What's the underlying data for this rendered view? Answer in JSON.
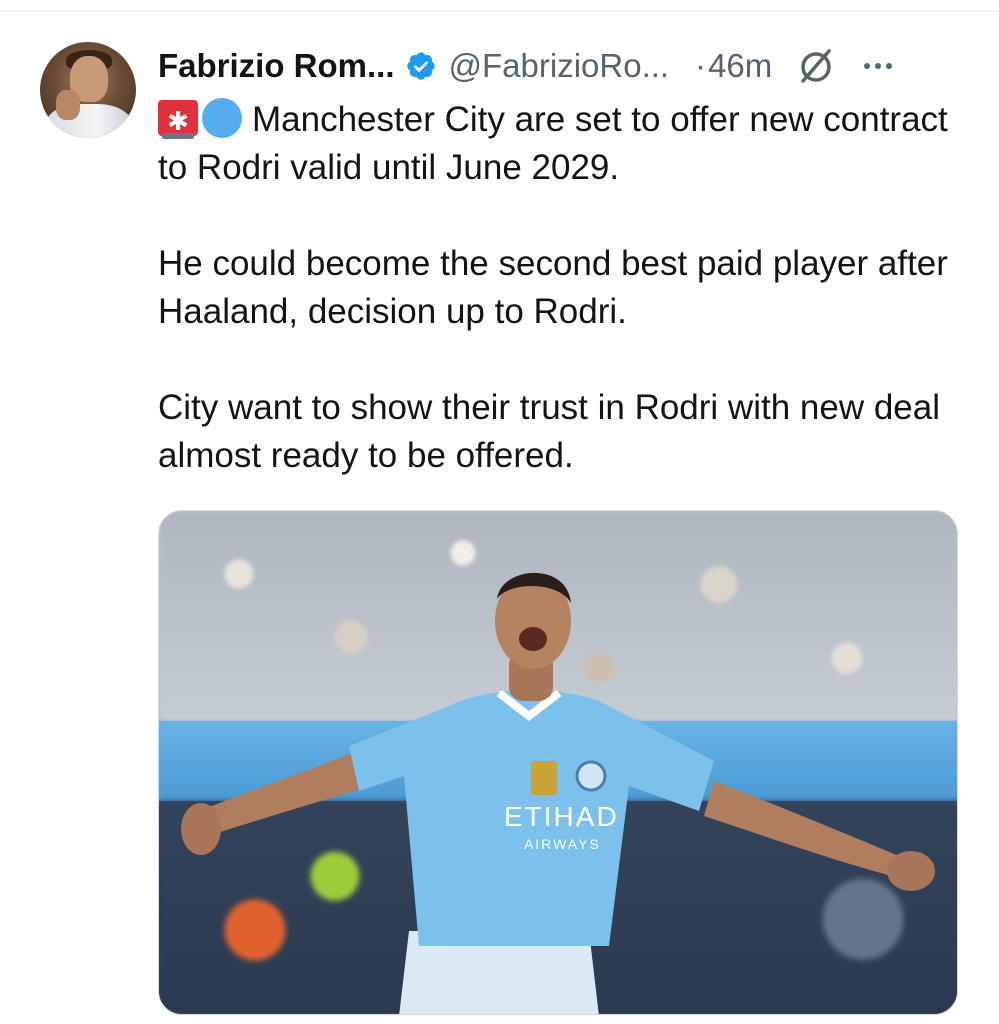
{
  "tweet": {
    "author_name": "Fabrizio Rom...",
    "handle": "@FabrizioRo...",
    "separator": "·",
    "time_ago": "46m",
    "paragraphs": [
      "Manchester City are set to offer new contract to Rodri valid until June 2029.",
      "He could become the second best paid player after Haaland, decision up to Rodri.",
      "City want to show their trust in Rodri with new deal almost ready to be offered."
    ],
    "leading_emojis": [
      "siren-emoji",
      "blue-circle-emoji"
    ],
    "media": {
      "shirt_text_line1": "ETIHAD",
      "shirt_text_line2": "AIRWAYS"
    }
  },
  "colors": {
    "primary_text": "#0f1419",
    "secondary_text": "#536471",
    "verified_blue": "#1d9bf0",
    "city_sky_blue": "#7cc0ec"
  },
  "icons": {
    "verified": "verified-badge-icon",
    "grok": "grok-icon",
    "more": "more-options-icon"
  }
}
